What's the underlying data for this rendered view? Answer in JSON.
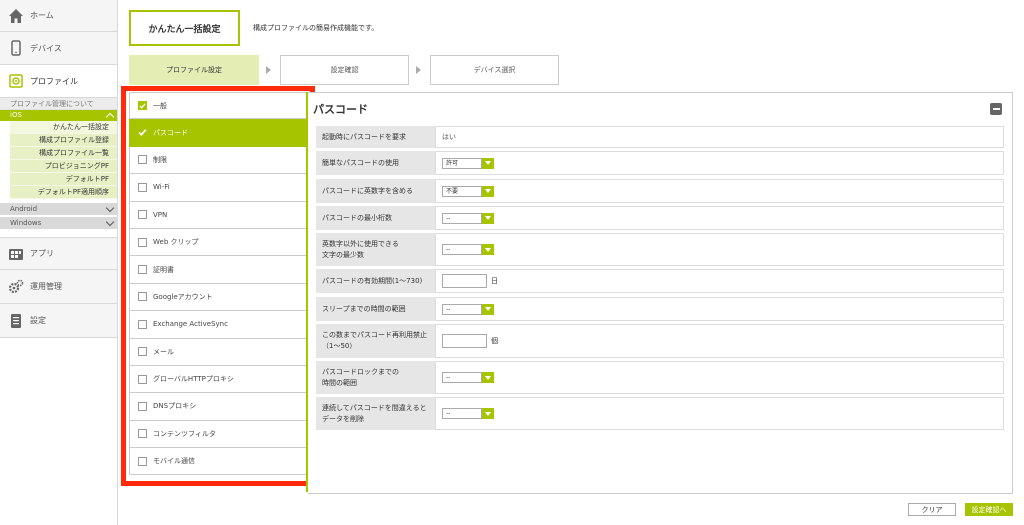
{
  "sidebar": {
    "home": "ホーム",
    "device": "デバイス",
    "profile": "プロファイル",
    "profile_about": "プロファイル管理について",
    "ios": "iOS",
    "ios_items": [
      "かんたん一括設定",
      "構成プロファイル登録",
      "構成プロファイル一覧",
      "プロビジョニングPF",
      "デフォルトPF",
      "デフォルトPF適用順序"
    ],
    "android": "Android",
    "windows": "Windows",
    "app": "アプリ",
    "operations": "運用管理",
    "settings": "設定"
  },
  "header": {
    "title": "かんたん一括設定",
    "description": "構成プロファイルの簡易作成機能です。"
  },
  "steps": [
    "プロファイル設定",
    "設定確認",
    "デバイス選択"
  ],
  "categories": [
    {
      "label": "一般",
      "checked": true
    },
    {
      "label": "パスコード",
      "selected": true
    },
    {
      "label": "制限"
    },
    {
      "label": "Wi-Fi"
    },
    {
      "label": "VPN"
    },
    {
      "label": "Web クリップ"
    },
    {
      "label": "証明書"
    },
    {
      "label": "Googleアカウント"
    },
    {
      "label": "Exchange ActiveSync"
    },
    {
      "label": "メール"
    },
    {
      "label": "グローバルHTTPプロキシ"
    },
    {
      "label": "DNSプロキシ"
    },
    {
      "label": "コンテンツフィルタ"
    },
    {
      "label": "モバイル通信"
    }
  ],
  "panel": {
    "title": "パスコード",
    "rows": [
      {
        "label": "起動時にパスコードを要求",
        "value": "はい"
      },
      {
        "label": "簡単なパスコードの使用",
        "select": "許可"
      },
      {
        "label": "パスコードに英数字を含める",
        "select": "不要"
      },
      {
        "label": "パスコードの最小桁数",
        "select": "--"
      },
      {
        "label_lines": [
          "英数字以外に使用できる",
          "文字の最少数"
        ],
        "select": "--"
      },
      {
        "label": "パスコードの有効期間(1〜730)",
        "unit": "日"
      },
      {
        "label": "スリープまでの時間の範囲",
        "select": "--"
      },
      {
        "label_lines": [
          "この数までパスコード再利用禁止",
          "（1〜50）"
        ],
        "unit": "個"
      },
      {
        "label_lines": [
          "パスコードロックまでの",
          "時間の範囲"
        ],
        "select": "--"
      },
      {
        "label_lines": [
          "連続してパスコードを間違えると",
          "データを削除"
        ],
        "select": "--"
      }
    ]
  },
  "buttons": {
    "clear": "クリア",
    "next": "設定確認へ"
  },
  "colors": {
    "accent": "#a6c400",
    "highlight_frame": "#ff2a0a"
  }
}
